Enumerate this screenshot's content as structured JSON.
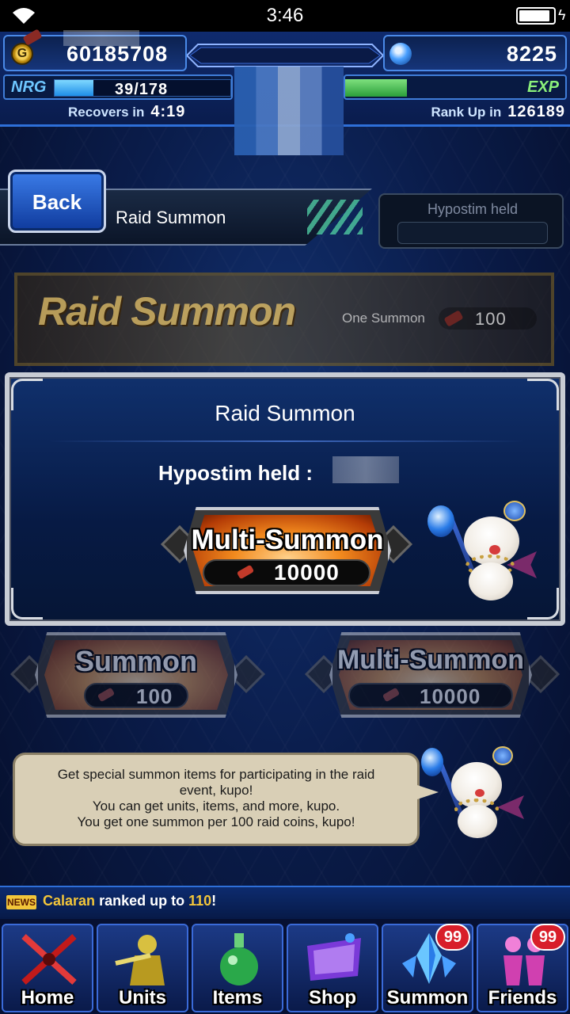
{
  "status_bar": {
    "time": "3:46"
  },
  "header": {
    "gil": "60185708",
    "lapis": "8225",
    "nrg_label": "NRG",
    "nrg_value": "39/178",
    "nrg_fraction": 0.22,
    "exp_label": "EXP",
    "exp_fraction": 0.28,
    "recover_label": "Recovers in",
    "recover_time": "4:19",
    "rankup_label": "Rank Up in",
    "rankup_value": "126189"
  },
  "title_bar": {
    "back_label": "Back",
    "title": "Raid Summon",
    "hypostim_label": "Hypostim held"
  },
  "banner": {
    "title": "Raid Summon",
    "one_summon": "One Summon",
    "cost": "100"
  },
  "dialog": {
    "title": "Raid Summon",
    "held_label": "Hypostim held :",
    "button_label": "Multi-Summon",
    "button_cost": "10000"
  },
  "buttons": {
    "summon_label": "Summon",
    "summon_cost": "100",
    "multi_label": "Multi-Summon",
    "multi_cost": "10000"
  },
  "speech": {
    "lines": [
      "Get special summon items for participating in the raid",
      "event, kupo!",
      "You can get units, items, and more, kupo.",
      "You get one summon per 100 raid coins, kupo!"
    ]
  },
  "news": {
    "badge": "NEWS",
    "name": "Calaran",
    "middle": "ranked up to",
    "value": "110",
    "end": "!"
  },
  "nav": {
    "items": [
      {
        "label": "Home",
        "badge": ""
      },
      {
        "label": "Units",
        "badge": ""
      },
      {
        "label": "Items",
        "badge": ""
      },
      {
        "label": "Shop",
        "badge": ""
      },
      {
        "label": "Summon",
        "badge": "99"
      },
      {
        "label": "Friends",
        "badge": "99"
      }
    ]
  }
}
